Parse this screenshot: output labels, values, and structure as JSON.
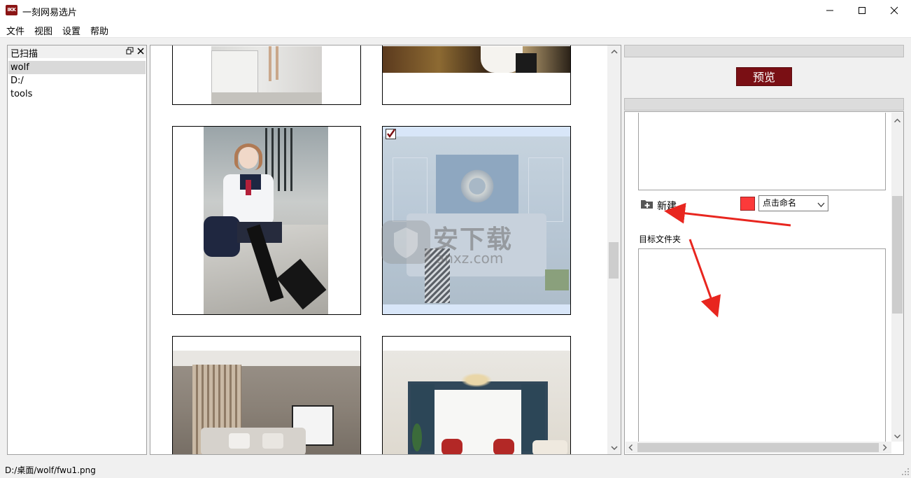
{
  "window": {
    "title": "一刻网易选片",
    "app_icon_text": "IKK",
    "controls": [
      "minimize-icon",
      "maximize-icon",
      "close-icon"
    ]
  },
  "menu": [
    "文件",
    "视图",
    "设置",
    "帮助"
  ],
  "scanned_panel": {
    "title": "已扫描",
    "items": [
      "wolf",
      "D:/",
      "tools"
    ],
    "selected_index": 0
  },
  "grid": {
    "items": [
      {
        "scene": "office-legs",
        "checked": false
      },
      {
        "scene": "autumn-leaves",
        "checked": false
      },
      {
        "scene": "schoolgirl-steps",
        "checked": false
      },
      {
        "scene": "blue-bedroom",
        "checked": true
      },
      {
        "scene": "gray-bedroom",
        "checked": false
      },
      {
        "scene": "classic-living-room",
        "checked": false
      }
    ]
  },
  "right_panel": {
    "preview_label": "预览",
    "new_label": "新建",
    "name_select": "点击命名",
    "swatch_color": "#fc3a3a",
    "target_folder_label": "目标文件夹"
  },
  "watermark": {
    "text": "安下载",
    "sub": "anxz.com"
  },
  "status": {
    "path": "D:/桌面/wolf/fwu1.png"
  },
  "colors": {
    "accent": "#7a0f14",
    "annotation_arrow": "#e8261f"
  }
}
